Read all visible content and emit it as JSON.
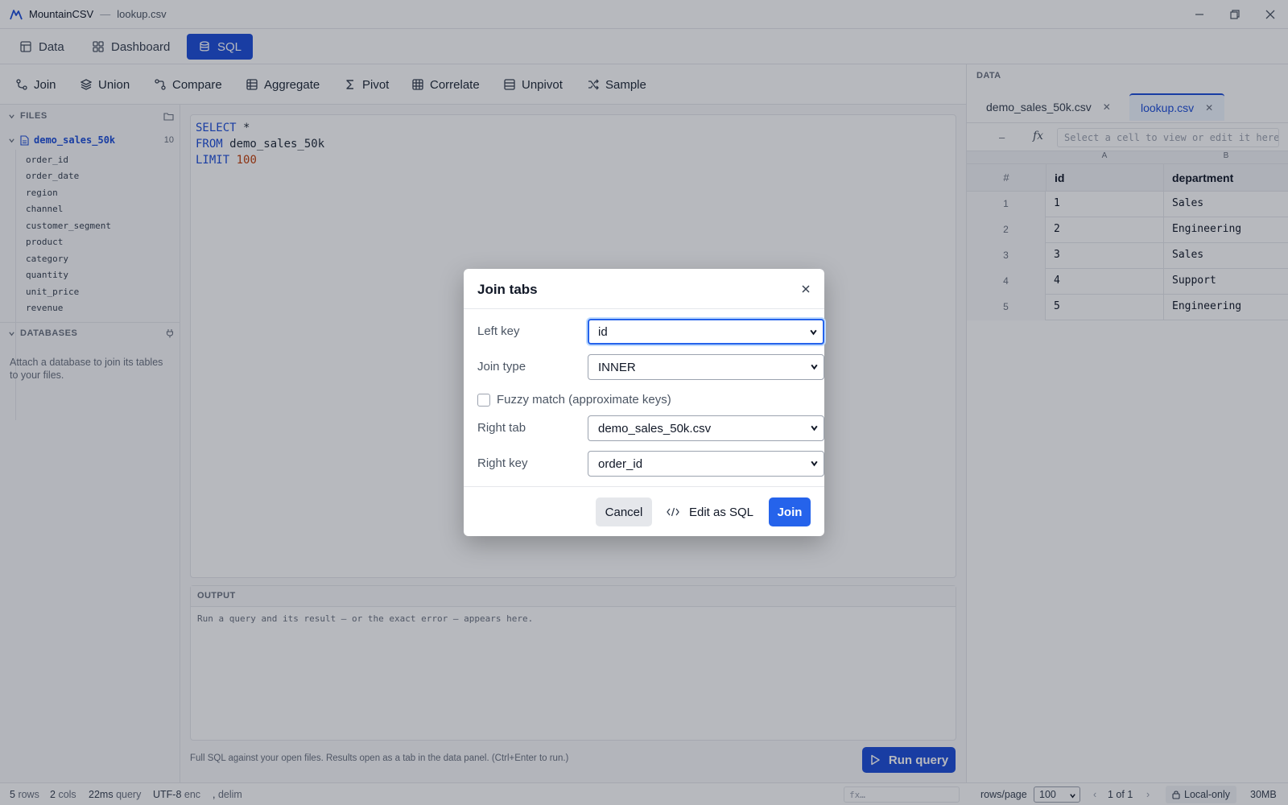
{
  "window": {
    "app_name": "MountainCSV",
    "file_name": "lookup.csv"
  },
  "modes": [
    {
      "label": "Data",
      "icon": "table-icon"
    },
    {
      "label": "Dashboard",
      "icon": "dashboard-icon"
    },
    {
      "label": "SQL",
      "icon": "database-icon",
      "active": true
    }
  ],
  "operations": [
    {
      "label": "Join",
      "icon": "join-icon"
    },
    {
      "label": "Union",
      "icon": "layers-icon"
    },
    {
      "label": "Compare",
      "icon": "compare-icon"
    },
    {
      "label": "Aggregate",
      "icon": "grid-icon"
    },
    {
      "label": "Pivot",
      "icon": "sigma-icon"
    },
    {
      "label": "Correlate",
      "icon": "grid-icon"
    },
    {
      "label": "Unpivot",
      "icon": "rows-icon"
    },
    {
      "label": "Sample",
      "icon": "shuffle-icon"
    }
  ],
  "sidebar": {
    "files_header": "FILES",
    "file": {
      "name": "demo_sales_50k",
      "count": "10"
    },
    "columns": [
      "order_id",
      "order_date",
      "region",
      "channel",
      "customer_segment",
      "product",
      "category",
      "quantity",
      "unit_price",
      "revenue"
    ],
    "databases_header": "DATABASES",
    "databases_hint": "Attach a database to join its tables to your files."
  },
  "editor": {
    "line1_kw": "SELECT",
    "line1_rest": " *",
    "line2_kw": "FROM",
    "line2_rest": " demo_sales_50k",
    "line3_kw": "LIMIT",
    "line3_num": "100"
  },
  "output": {
    "header": "OUTPUT",
    "message": "Run a query and its result — or the exact error — appears here."
  },
  "footer_hint": "Full SQL against your open files. Results open as a tab in the data panel. (Ctrl+Enter to run.)",
  "run_button": "Run query",
  "data_panel": {
    "label": "DATA",
    "tabs": [
      {
        "label": "demo_sales_50k.csv",
        "active": false
      },
      {
        "label": "lookup.csv",
        "active": true
      }
    ],
    "cell_ref": "–",
    "fx": "fx",
    "formula_placeholder": "Select a cell to view or edit it here",
    "col_letters": [
      "A",
      "B"
    ],
    "headers": {
      "rownum": "#",
      "col_a": "id",
      "col_b": "department"
    },
    "rows": [
      {
        "n": "1",
        "id": "1",
        "department": "Sales"
      },
      {
        "n": "2",
        "id": "2",
        "department": "Engineering"
      },
      {
        "n": "3",
        "id": "3",
        "department": "Sales"
      },
      {
        "n": "4",
        "id": "4",
        "department": "Support"
      },
      {
        "n": "5",
        "id": "5",
        "department": "Engineering"
      }
    ]
  },
  "status": {
    "rows": "5",
    "rows_unit": "rows",
    "cols": "2",
    "cols_unit": "cols",
    "query_time": "22ms",
    "query_unit": "query",
    "encoding": "UTF-8",
    "encoding_unit": "enc",
    "delimiter": ",",
    "delimiter_unit": "delim",
    "fx_placeholder": "fx…",
    "rows_per_page_label": "rows/page",
    "rows_per_page": "100",
    "page": "1 of 1",
    "local": "Local-only",
    "memory": "30MB"
  },
  "dialog": {
    "title": "Join tabs",
    "left_key_label": "Left key",
    "left_key_value": "id",
    "join_type_label": "Join type",
    "join_type_value": "INNER",
    "fuzzy_label": "Fuzzy match (approximate keys)",
    "right_tab_label": "Right tab",
    "right_tab_value": "demo_sales_50k.csv",
    "right_key_label": "Right key",
    "right_key_value": "order_id",
    "cancel": "Cancel",
    "edit_sql": "Edit as SQL",
    "join": "Join"
  },
  "colors": {
    "accent": "#1d4ed8",
    "accent_light": "#2563eb",
    "number": "#c2410c"
  }
}
